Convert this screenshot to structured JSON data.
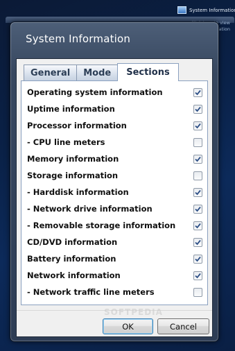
{
  "desktop_gadget": {
    "title": "System Information",
    "subtitle": "Click icon to view detailed information"
  },
  "window": {
    "title": "System Information"
  },
  "tabs": [
    {
      "label": "General",
      "active": false
    },
    {
      "label": "Mode",
      "active": false
    },
    {
      "label": "Sections",
      "active": true
    }
  ],
  "sections": [
    {
      "label": "Operating system information",
      "checked": true
    },
    {
      "label": "Uptime information",
      "checked": true
    },
    {
      "label": "Processor information",
      "checked": true
    },
    {
      "label": " - CPU line meters",
      "checked": false
    },
    {
      "label": "Memory information",
      "checked": true
    },
    {
      "label": "Storage information",
      "checked": false
    },
    {
      "label": " - Harddisk information",
      "checked": true
    },
    {
      "label": " - Network drive information",
      "checked": true
    },
    {
      "label": " - Removable storage information",
      "checked": true
    },
    {
      "label": "CD/DVD information",
      "checked": true
    },
    {
      "label": "Battery information",
      "checked": true
    },
    {
      "label": "Network information",
      "checked": true
    },
    {
      "label": " - Network traffic line meters",
      "checked": false
    }
  ],
  "buttons": {
    "ok_label": "OK",
    "cancel_label": "Cancel"
  },
  "watermark": "SOFTPEDIA"
}
